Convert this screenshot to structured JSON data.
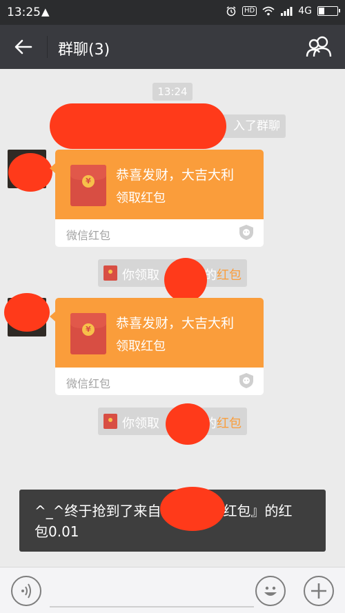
{
  "status_bar": {
    "time": "13:25",
    "warning_glyph": "▲",
    "hd_label": "HD",
    "network": "4G"
  },
  "header": {
    "title": "群聊(3)"
  },
  "chat": {
    "timestamp": "13:24",
    "join_notice_visible": "入了群聊",
    "messages": [
      {
        "type": "red_packet",
        "greeting": "恭喜发财，大吉大利",
        "action": "领取红包",
        "footer": "微信红包",
        "receipt_prefix": "你领取",
        "receipt_suffix": "红包",
        "receipt_mid": "的"
      },
      {
        "type": "red_packet",
        "greeting": "恭喜发财，大吉大利",
        "action": "领取红包",
        "footer": "微信红包",
        "receipt_prefix": "你领取",
        "receipt_suffix": "红包",
        "receipt_mid": "的"
      }
    ]
  },
  "toast": {
    "line1_start": "^_^终于抢到了来自",
    "line1_end": "红包』的红",
    "line2": "包0.01"
  },
  "colors": {
    "packet_orange": "#fa9d3b",
    "envelope_red": "#d84e43",
    "redaction": "#ff3a1a"
  }
}
